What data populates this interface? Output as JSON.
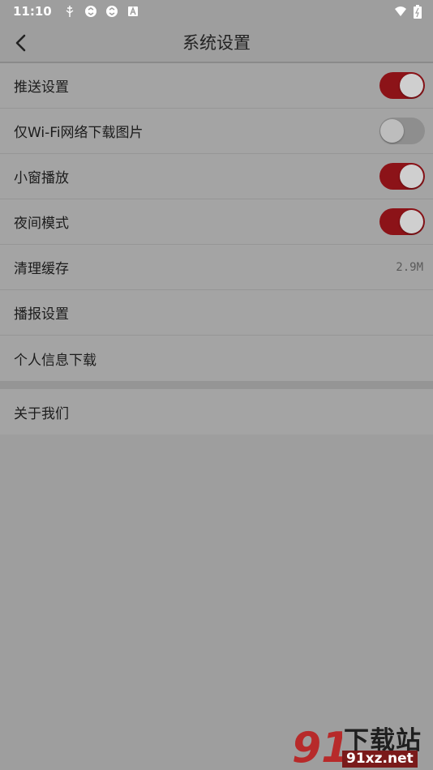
{
  "status": {
    "time": "11:10",
    "icons_left": [
      "usb-debug-icon",
      "sync-icon",
      "sync-icon",
      "android-icon"
    ],
    "icons_right": [
      "wifi-icon",
      "battery-icon"
    ]
  },
  "header": {
    "title": "系统设置",
    "back_icon": "chevron-left-icon"
  },
  "settings": {
    "items": [
      {
        "label": "推送设置",
        "toggle": true
      },
      {
        "label": "仅Wi-Fi网络下载图片",
        "toggle": false
      },
      {
        "label": "小窗播放",
        "toggle": true
      },
      {
        "label": "夜间模式",
        "toggle": true
      },
      {
        "label": "清理缓存",
        "value": "2.9M"
      },
      {
        "label": "播报设置"
      },
      {
        "label": "个人信息下载"
      }
    ],
    "about": {
      "label": "关于我们"
    }
  },
  "watermark": {
    "main": "下载站",
    "url": "91xz.net",
    "logo_text": "91"
  },
  "colors": {
    "accent": "#8c1318",
    "overlay": "#9e9e9e"
  }
}
